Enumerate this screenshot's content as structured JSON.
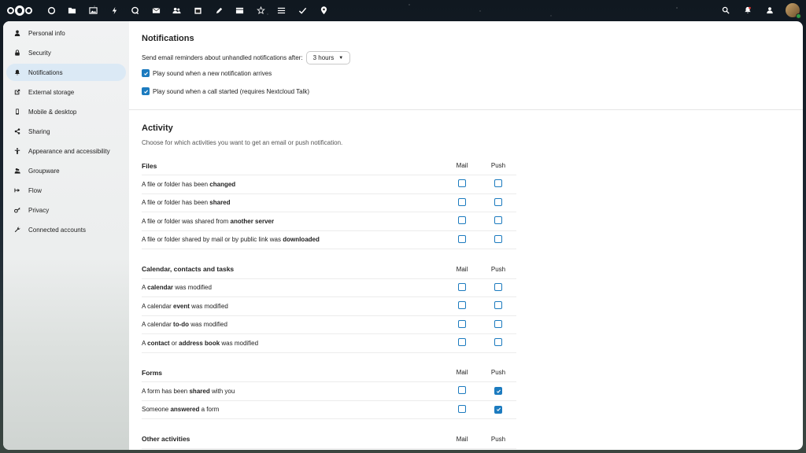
{
  "topbar": {
    "apps": [
      "dashboard-icon",
      "files-icon",
      "photos-icon",
      "activity-icon",
      "talk-icon",
      "mail-icon",
      "contacts-icon",
      "calendar-icon",
      "notes-icon",
      "deck-icon",
      "bookmarks-icon",
      "tasks-icon",
      "checklist-icon",
      "maps-icon"
    ],
    "right": [
      "search-icon",
      "notifications-icon",
      "contacts-menu-icon"
    ]
  },
  "sidebar": {
    "items": [
      {
        "label": "Personal info",
        "icon": "person-icon"
      },
      {
        "label": "Security",
        "icon": "lock-icon"
      },
      {
        "label": "Notifications",
        "icon": "bell-icon",
        "active": true
      },
      {
        "label": "External storage",
        "icon": "external-link-icon"
      },
      {
        "label": "Mobile & desktop",
        "icon": "phone-icon"
      },
      {
        "label": "Sharing",
        "icon": "share-icon"
      },
      {
        "label": "Appearance and accessibility",
        "icon": "accessibility-icon"
      },
      {
        "label": "Groupware",
        "icon": "group-icon"
      },
      {
        "label": "Flow",
        "icon": "flow-icon"
      },
      {
        "label": "Privacy",
        "icon": "key-icon"
      },
      {
        "label": "Connected accounts",
        "icon": "wrench-icon"
      }
    ]
  },
  "notifications": {
    "title": "Notifications",
    "reminder_label": "Send email reminders about unhandled notifications after:",
    "reminder_value": "3 hours",
    "sound_notification": "Play sound when a new notification arrives",
    "sound_call": "Play sound when a call started (requires Nextcloud Talk)"
  },
  "activity": {
    "title": "Activity",
    "description": "Choose for which activities you want to get an email or push notification.",
    "col_mail": "Mail",
    "col_push": "Push",
    "groups": [
      {
        "name": "Files",
        "rows": [
          {
            "pre": "A file or folder has been ",
            "bold": "changed",
            "post": "",
            "mail": false,
            "push": false
          },
          {
            "pre": "A file or folder has been ",
            "bold": "shared",
            "post": "",
            "mail": false,
            "push": false
          },
          {
            "pre": "A file or folder was shared from ",
            "bold": "another server",
            "post": "",
            "mail": false,
            "push": false
          },
          {
            "pre": "A file or folder shared by mail or by public link was ",
            "bold": "downloaded",
            "post": "",
            "mail": false,
            "push": false
          }
        ]
      },
      {
        "name": "Calendar, contacts and tasks",
        "rows": [
          {
            "pre": "A ",
            "bold": "calendar",
            "post": " was modified",
            "mail": false,
            "push": false
          },
          {
            "pre": "A calendar ",
            "bold": "event",
            "post": " was modified",
            "mail": false,
            "push": false
          },
          {
            "pre": "A calendar ",
            "bold": "to-do",
            "post": " was modified",
            "mail": false,
            "push": false
          },
          {
            "pre": "A ",
            "bold": "contact",
            "mid": " or ",
            "bold2": "address book",
            "post": " was modified",
            "mail": false,
            "push": false
          }
        ]
      },
      {
        "name": "Forms",
        "rows": [
          {
            "pre": "A form has been ",
            "bold": "shared",
            "post": " with you",
            "mail": false,
            "push": true
          },
          {
            "pre": "Someone ",
            "bold": "answered",
            "post": " a form",
            "mail": false,
            "push": true
          }
        ]
      },
      {
        "name": "Other activities",
        "rows": []
      }
    ]
  },
  "colors": {
    "accent": "#1c7bbf",
    "active_nav": "#dbe9f5"
  }
}
